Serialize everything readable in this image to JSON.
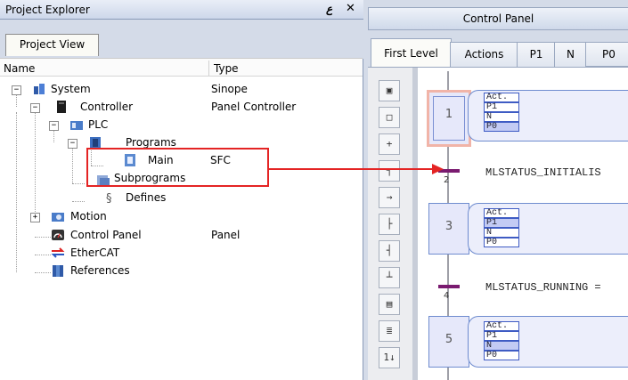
{
  "explorer": {
    "title": "Project Explorer",
    "pin_glyph": "ع",
    "close_glyph": "✕",
    "tab": "Project View",
    "columns": {
      "name": "Name",
      "type": "Type"
    },
    "expander_minus": "−",
    "expander_plus": "+",
    "tree": [
      {
        "label": "System",
        "type": "Sinope"
      },
      {
        "label": "Controller",
        "type": "Panel Controller"
      },
      {
        "label": "PLC",
        "type": ""
      },
      {
        "label": "Programs",
        "type": ""
      },
      {
        "label": "Main",
        "type": "SFC"
      },
      {
        "label": "Subprograms",
        "type": ""
      },
      {
        "label": "Defines",
        "type": ""
      },
      {
        "label": "Motion",
        "type": ""
      },
      {
        "label": "Control Panel",
        "type": "Panel"
      },
      {
        "label": "EtherCAT",
        "type": ""
      },
      {
        "label": "References",
        "type": ""
      }
    ]
  },
  "control_panel": {
    "title": "Control Panel",
    "tabs": [
      "First Level",
      "Actions",
      "P1",
      "N",
      "P0"
    ],
    "active_tab": "First Level",
    "toolbar_glyphs": [
      "▣",
      "□",
      "+",
      "┐",
      "→",
      "├",
      "┤",
      "┴",
      "▤",
      "≣",
      "1↓"
    ],
    "qualifiers": [
      "Act.",
      "P1",
      "N",
      "P0"
    ],
    "steps": [
      {
        "number": "1",
        "initial": true
      },
      {
        "number": "3",
        "initial": false
      },
      {
        "number": "5",
        "initial": false
      }
    ],
    "transitions": [
      {
        "number": "2",
        "label": "MLSTATUS_INITIALIS"
      },
      {
        "number": "4",
        "label": "MLSTATUS_RUNNING ="
      }
    ]
  },
  "colors": {
    "highlight": "#e42424",
    "transition": "#7a1b70",
    "step_border": "#6f8ccf",
    "initial_step_border": "#f1b4a8"
  }
}
